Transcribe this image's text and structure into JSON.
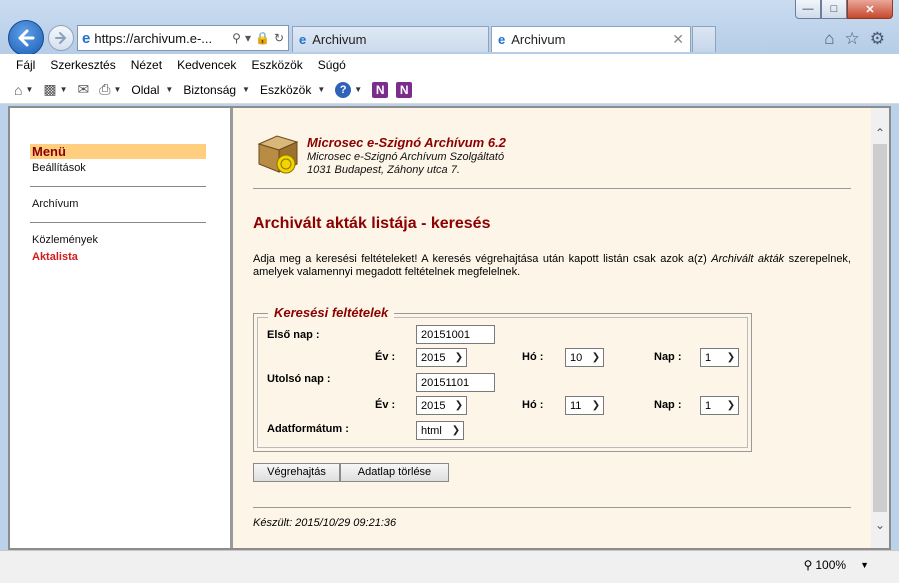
{
  "browser": {
    "address_url": "https://archivum.e-...",
    "tabs": [
      {
        "label": "Archivum"
      },
      {
        "label": "Archivum"
      }
    ],
    "menu": [
      "Fájl",
      "Szerkesztés",
      "Nézet",
      "Kedvencek",
      "Eszközök",
      "Súgó"
    ],
    "command_bar": {
      "page_label": "Oldal",
      "security_label": "Biztonság",
      "tools_label": "Eszközök"
    },
    "zoom": "100%"
  },
  "sidebar": {
    "menu_title": "Menü",
    "items": [
      {
        "label": "Beállítások"
      },
      {
        "label": "Archívum"
      },
      {
        "label": "Közlemények"
      },
      {
        "label": "Aktalista"
      }
    ]
  },
  "header": {
    "app_title": "Microsec e-Szignó Archívum 6.2",
    "provider": "Microsec e-Szignó Archívum Szolgáltató",
    "address": "1031 Budapest, Záhony utca 7."
  },
  "page": {
    "title": "Archivált akták listája - keresés",
    "intro_start": "Adja meg a keresési feltételeket! A keresés végrehajtása után kapott listán csak azok a(z) ",
    "intro_em": "Archivált akták",
    "intro_end": " szerepelnek, amelyek valamennyi megadott feltételnek megfelelnek."
  },
  "search": {
    "legend": "Keresési feltételek",
    "first_day": {
      "label": "Első nap :",
      "value": "20151001",
      "year_label": "Év :",
      "year_value": "2015",
      "month_label": "Hó :",
      "month_value": "10",
      "day_label": "Nap :",
      "day_value": "1"
    },
    "last_day": {
      "label": "Utolsó nap :",
      "value": "20151101",
      "year_label": "Év :",
      "year_value": "2015",
      "month_label": "Hó :",
      "month_value": "11",
      "day_label": "Nap :",
      "day_value": "1"
    },
    "format": {
      "label": "Adatformátum :",
      "value": "html"
    }
  },
  "buttons": {
    "execute": "Végrehajtás",
    "clear": "Adatlap törlése"
  },
  "footer": {
    "created": "Készült: 2015/10/29 09:21:36"
  }
}
